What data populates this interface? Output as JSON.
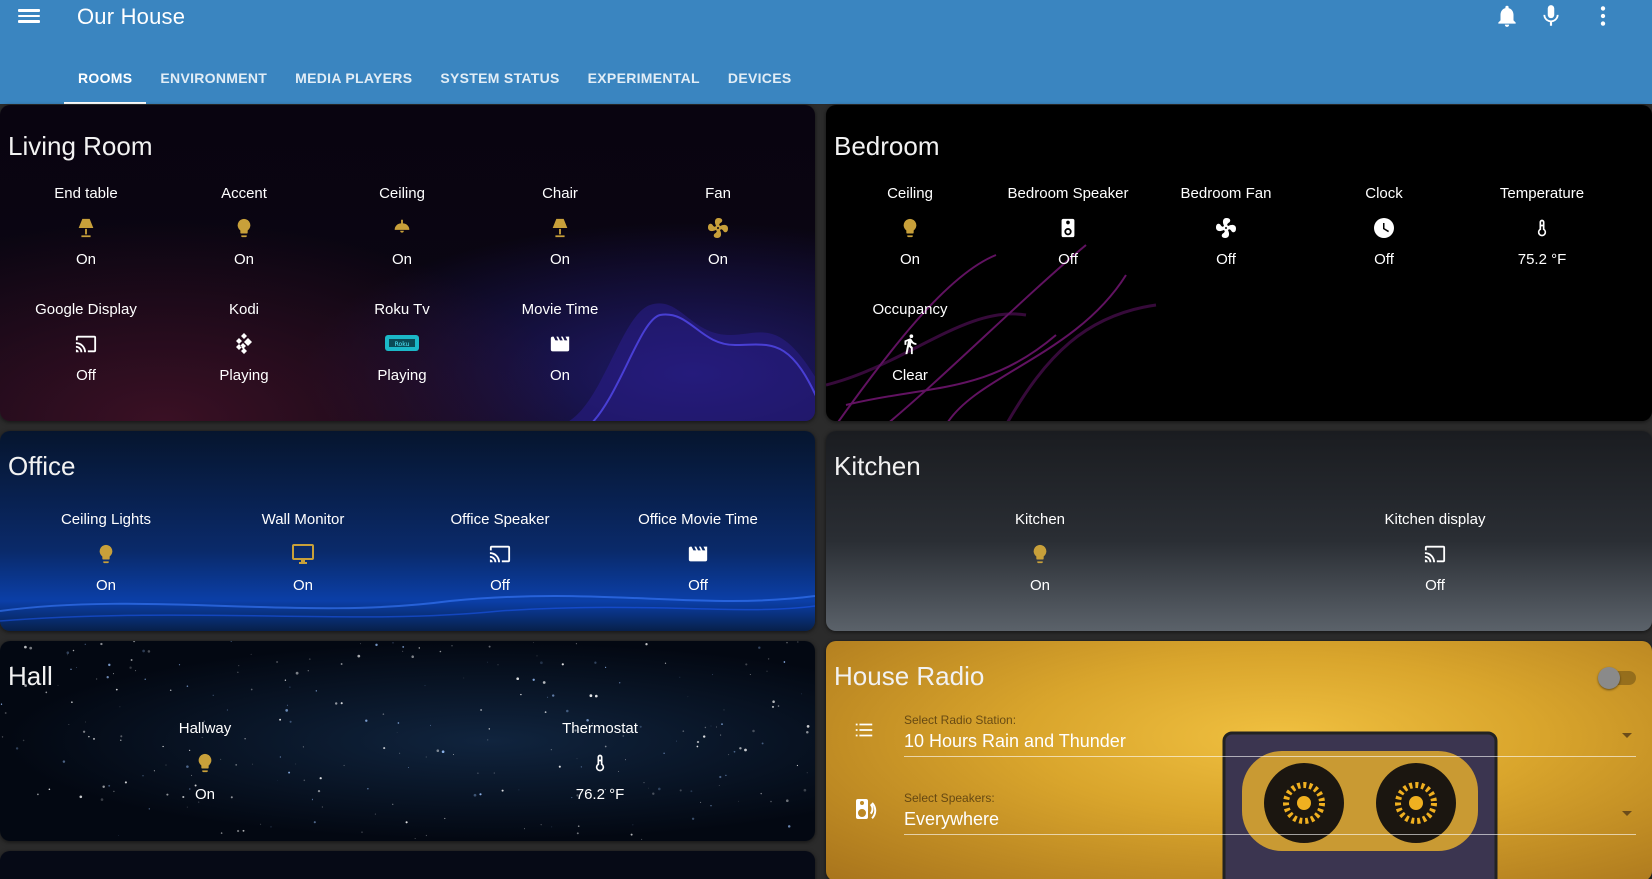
{
  "app": {
    "title": "Our House"
  },
  "header": {
    "icons": [
      "menu-icon",
      "bell-icon",
      "microphone-icon",
      "more-vertical-icon"
    ]
  },
  "tabs": [
    {
      "label": "ROOMS",
      "active": true
    },
    {
      "label": "ENVIRONMENT",
      "active": false
    },
    {
      "label": "MEDIA PLAYERS",
      "active": false
    },
    {
      "label": "SYSTEM STATUS",
      "active": false
    },
    {
      "label": "EXPERIMENTAL",
      "active": false
    },
    {
      "label": "DEVICES",
      "active": false
    }
  ],
  "colors": {
    "header": "#3a85c0",
    "icon_on": "#c8a03a",
    "icon_off": "#ffffff"
  },
  "living_room": {
    "title": "Living Room",
    "entities": [
      {
        "name": "End table",
        "icon": "lamp-icon",
        "state": "On"
      },
      {
        "name": "Accent",
        "icon": "lightbulb-icon",
        "state": "On"
      },
      {
        "name": "Ceiling",
        "icon": "ceiling-light-icon",
        "state": "On"
      },
      {
        "name": "Chair",
        "icon": "lamp-icon",
        "state": "On"
      },
      {
        "name": "Fan",
        "icon": "fan-icon",
        "state": "On"
      },
      {
        "name": "Google Display",
        "icon": "cast-icon",
        "state": "Off"
      },
      {
        "name": "Kodi",
        "icon": "kodi-icon",
        "state": "Playing"
      },
      {
        "name": "Roku Tv",
        "icon": "roku-icon",
        "state": "Playing"
      },
      {
        "name": "Movie Time",
        "icon": "movie-icon",
        "state": "On"
      }
    ]
  },
  "bedroom": {
    "title": "Bedroom",
    "entities": [
      {
        "name": "Ceiling",
        "icon": "lightbulb-icon",
        "state": "On"
      },
      {
        "name": "Bedroom Speaker",
        "icon": "speaker-icon",
        "state": "Off"
      },
      {
        "name": "Bedroom Fan",
        "icon": "fan-icon",
        "state": "Off"
      },
      {
        "name": "Clock",
        "icon": "clock-icon",
        "state": "Off"
      },
      {
        "name": "Temperature",
        "icon": "thermometer-icon",
        "state": "75.2 °F"
      },
      {
        "name": "Occupancy",
        "icon": "walk-icon",
        "state": "Clear"
      }
    ]
  },
  "office": {
    "title": "Office",
    "entities": [
      {
        "name": "Ceiling Lights",
        "icon": "lightbulb-icon",
        "state": "On"
      },
      {
        "name": "Wall Monitor",
        "icon": "monitor-icon",
        "state": "On"
      },
      {
        "name": "Office Speaker",
        "icon": "cast-icon",
        "state": "Off"
      },
      {
        "name": "Office Movie Time",
        "icon": "movie-icon",
        "state": "Off"
      }
    ]
  },
  "kitchen": {
    "title": "Kitchen",
    "entities": [
      {
        "name": "Kitchen",
        "icon": "lightbulb-icon",
        "state": "On"
      },
      {
        "name": "Kitchen display",
        "icon": "cast-icon",
        "state": "Off"
      }
    ]
  },
  "hall": {
    "title": "Hall",
    "entities": [
      {
        "name": "Hallway",
        "icon": "lightbulb-icon",
        "state": "On"
      },
      {
        "name": "Thermostat",
        "icon": "thermometer-icon",
        "state": "76.2 °F"
      }
    ]
  },
  "radio": {
    "title": "House Radio",
    "station_label": "Select Radio Station:",
    "station_value": "10 Hours Rain and Thunder",
    "speakers_label": "Select Speakers:",
    "speakers_value": "Everywhere",
    "toggle_on": false
  }
}
